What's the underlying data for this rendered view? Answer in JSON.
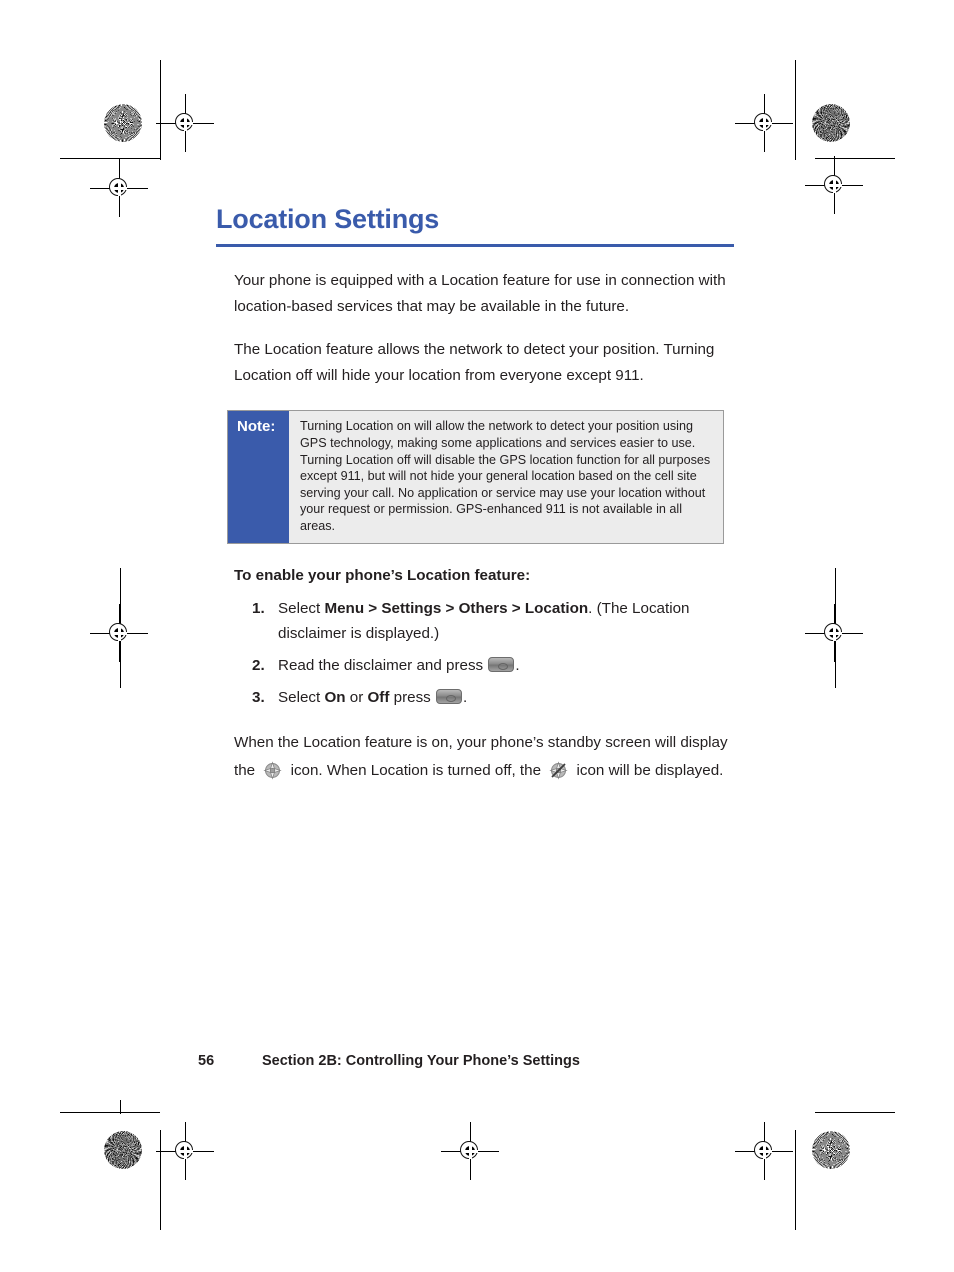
{
  "document": {
    "title": "Location Settings",
    "paragraphs": [
      "Your phone is equipped with a Location feature for use in connection with location-based services that may be available in the future.",
      "The Location feature allows the network to detect your position. Turning Location off will hide your location from everyone except 911."
    ],
    "note": {
      "label": "Note:",
      "text": "Turning Location on will allow the network to detect your position using GPS technology, making some applications and services easier to use. Turning Location off will disable the GPS location function for all purposes except 911, but will not hide your general location based on the cell site serving your call. No application or service may use your location without your request or permission. GPS-enhanced 911 is not available in all areas."
    },
    "procedure": {
      "lead_in": "To enable your phone’s Location feature:",
      "steps": [
        {
          "number": "1.",
          "parts": [
            {
              "text": "Select ",
              "bold": false
            },
            {
              "text": "Menu > Settings > Others > Location",
              "bold": true
            },
            {
              "text": ". (The Location disclaimer is displayed.)",
              "bold": false
            }
          ]
        },
        {
          "number": "2.",
          "parts": [
            {
              "text": "Read the disclaimer and press ",
              "bold": false
            },
            {
              "icon": "key-button"
            },
            {
              "text": ".",
              "bold": false
            }
          ]
        },
        {
          "number": "3.",
          "parts": [
            {
              "text": "Select ",
              "bold": false
            },
            {
              "text": "On",
              "bold": true
            },
            {
              "text": " or ",
              "bold": false
            },
            {
              "text": "Off",
              "bold": true
            },
            {
              "text": " press ",
              "bold": false
            },
            {
              "icon": "key-button"
            },
            {
              "text": ".",
              "bold": false
            }
          ]
        }
      ]
    },
    "closing": {
      "parts": [
        {
          "text": "When the Location feature is on, your phone’s standby screen will display the "
        },
        {
          "icon": "location-on-icon"
        },
        {
          "text": " icon. When Location is turned off, the "
        },
        {
          "icon": "location-off-icon"
        },
        {
          "text": " icon will be displayed."
        }
      ]
    },
    "footer": {
      "page_number": "56",
      "running_head": "Section 2B: Controlling Your Phone’s Settings"
    },
    "colors": {
      "heading_blue": "#3a5bab",
      "note_panel_blue": "#3a5bab",
      "note_background": "#ececec",
      "note_border": "#9a9a9a",
      "body_text": "#231f20"
    }
  }
}
